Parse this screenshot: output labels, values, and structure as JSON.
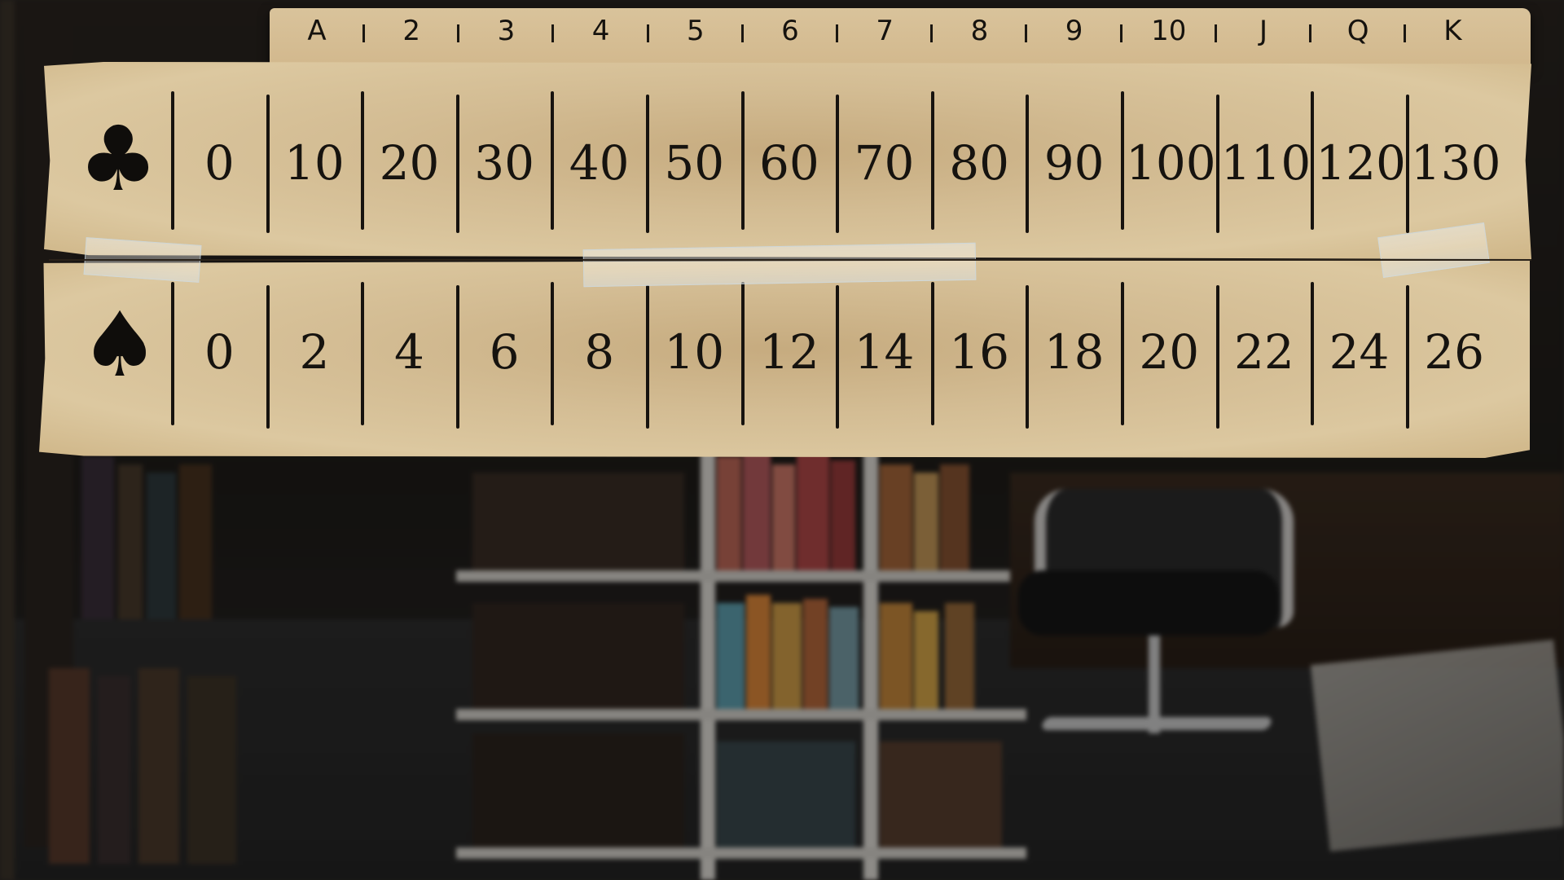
{
  "header": {
    "ranks": [
      "A",
      "2",
      "3",
      "4",
      "5",
      "6",
      "7",
      "8",
      "9",
      "10",
      "J",
      "Q",
      "K"
    ]
  },
  "clubs_row": {
    "suit_icon": "club-icon",
    "values": [
      "0",
      "10",
      "20",
      "30",
      "40",
      "50",
      "60",
      "70",
      "80",
      "90",
      "100",
      "110",
      "120",
      "130"
    ]
  },
  "spades_row": {
    "suit_icon": "spade-icon",
    "values": [
      "0",
      "2",
      "4",
      "6",
      "8",
      "10",
      "12",
      "14",
      "16",
      "18",
      "20",
      "22",
      "24",
      "26"
    ]
  },
  "colors": {
    "parchment": "#d3bc93",
    "ink": "#16130f"
  }
}
